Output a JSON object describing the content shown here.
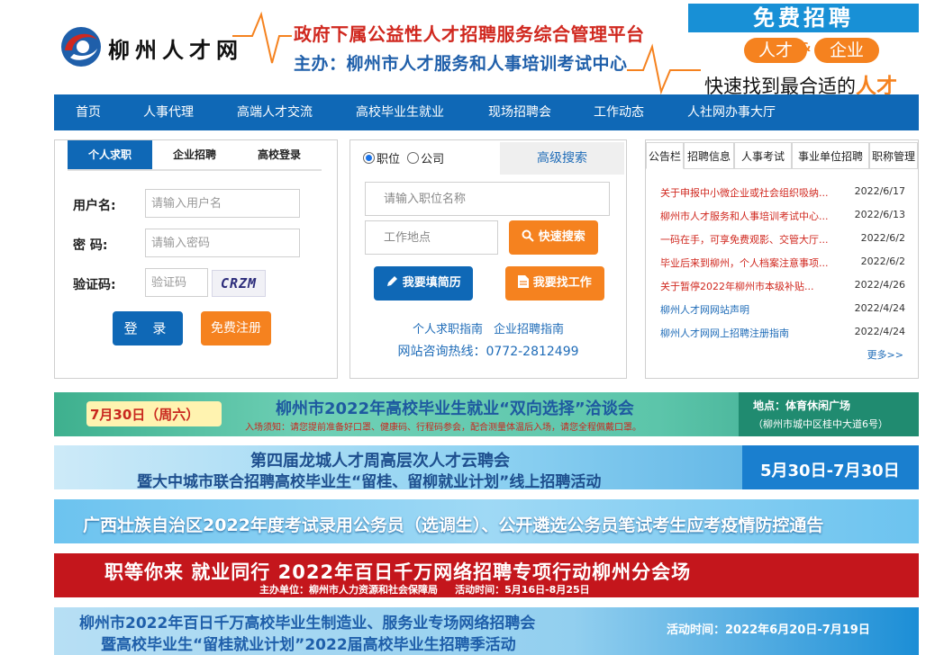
{
  "header": {
    "logo_text": "柳州人才网",
    "slogan_line1": "政府下属公益性人才招聘服务综合管理平台",
    "slogan_line2": "主办：柳州市人才服务和人事培训考试中心",
    "ad_title": "免费招聘",
    "ad_pill_left": "人才",
    "ad_amp": "&",
    "ad_pill_right": "企业",
    "ad_tag_main": "快速找到最合适的",
    "ad_tag_highlight": "人才"
  },
  "nav": {
    "items": [
      "首页",
      "人事代理",
      "高端人才交流",
      "高校毕业生就业",
      "现场招聘会",
      "工作动态",
      "人社网办事大厅"
    ]
  },
  "login": {
    "tabs": [
      "个人求职",
      "企业招聘",
      "高校登录"
    ],
    "username_label": "用户名:",
    "username_placeholder": "请输入用户名",
    "password_label": "密  码:",
    "password_placeholder": "请输入密码",
    "captcha_label": "验证码:",
    "captcha_placeholder": "验证码",
    "captcha_text": "CRZM",
    "login_button": "登 录",
    "register_button": "免费注册"
  },
  "search": {
    "radio_position": "职位",
    "radio_company": "公司",
    "advanced_tab": "高级搜索",
    "keyword_placeholder": "请输入职位名称",
    "location_placeholder": "工作地点",
    "quick_search_button": "快速搜索",
    "resume_button": "我要填简历",
    "find_job_button": "我要找工作",
    "guide_personal": "个人求职指南",
    "guide_company": "企业招聘指南",
    "hotline": "网站咨询热线：0772-2812499"
  },
  "notices": {
    "tabs": [
      "公告栏",
      "招聘信息",
      "人事考试",
      "事业单位招聘",
      "职称管理"
    ],
    "items": [
      {
        "title": "关于申报中小微企业或社会组织吸纳...",
        "date": "2022/6/17",
        "color": "red"
      },
      {
        "title": "柳州市人才服务和人事培训考试中心...",
        "date": "2022/6/13",
        "color": "red"
      },
      {
        "title": "一码在手，可享免费观影、交管大厅...",
        "date": "2022/6/2",
        "color": "red"
      },
      {
        "title": "毕业后来到柳州，个人档案注意事项...",
        "date": "2022/6/2",
        "color": "red"
      },
      {
        "title": "关于暂停2022年柳州市本级补贴...",
        "date": "2022/4/26",
        "color": "red"
      },
      {
        "title": "柳州人才网网站声明",
        "date": "2022/4/24",
        "color": "blue"
      },
      {
        "title": "柳州人才网网上招聘注册指南",
        "date": "2022/4/24",
        "color": "blue"
      }
    ],
    "more": "更多>>"
  },
  "banners": {
    "b1_date": "7月30日（周六）",
    "b1_title": "柳州市2022年高校毕业生就业“双向选择”洽谈会",
    "b1_notice": "入场须知：请您提前准备好口罩、健康码、行程码参会，配合测量体温后入场，请您全程佩戴口罩。",
    "b1_place": "地点：体育休闲广场",
    "b1_addr": "（柳州市城中区桂中大道6号）",
    "b2_line1": "第四届龙城人才周高层次人才云聘会",
    "b2_line2": "暨大中城市联合招聘高校毕业生“留桂、留柳就业计划”线上招聘活动",
    "b2_date": "5月30日-7月30日",
    "b3_text": "广西壮族自治区2022年度考试录用公务员（选调生）、公开遴选公务员笔试考生应考疫情防控通告",
    "b4_title": "职等你来  就业同行  2022年百日千万网络招聘专项行动柳州分会场",
    "b4_sub": "主办单位：柳州市人力资源和社会保障局     活动时间：5月16日-8月25日",
    "b5_line1": "柳州市2022年百日千万高校毕业生制造业、服务业专场网络招聘会",
    "b5_line2": "暨高校毕业生“留桂就业计划”2022届高校毕业生招聘季活动",
    "b5_date": "活动时间：2022年6月20日-7月19日"
  },
  "colors": {
    "primary_blue": "#0f68b6",
    "accent_orange": "#f5821f",
    "alert_red": "#d0281f"
  }
}
